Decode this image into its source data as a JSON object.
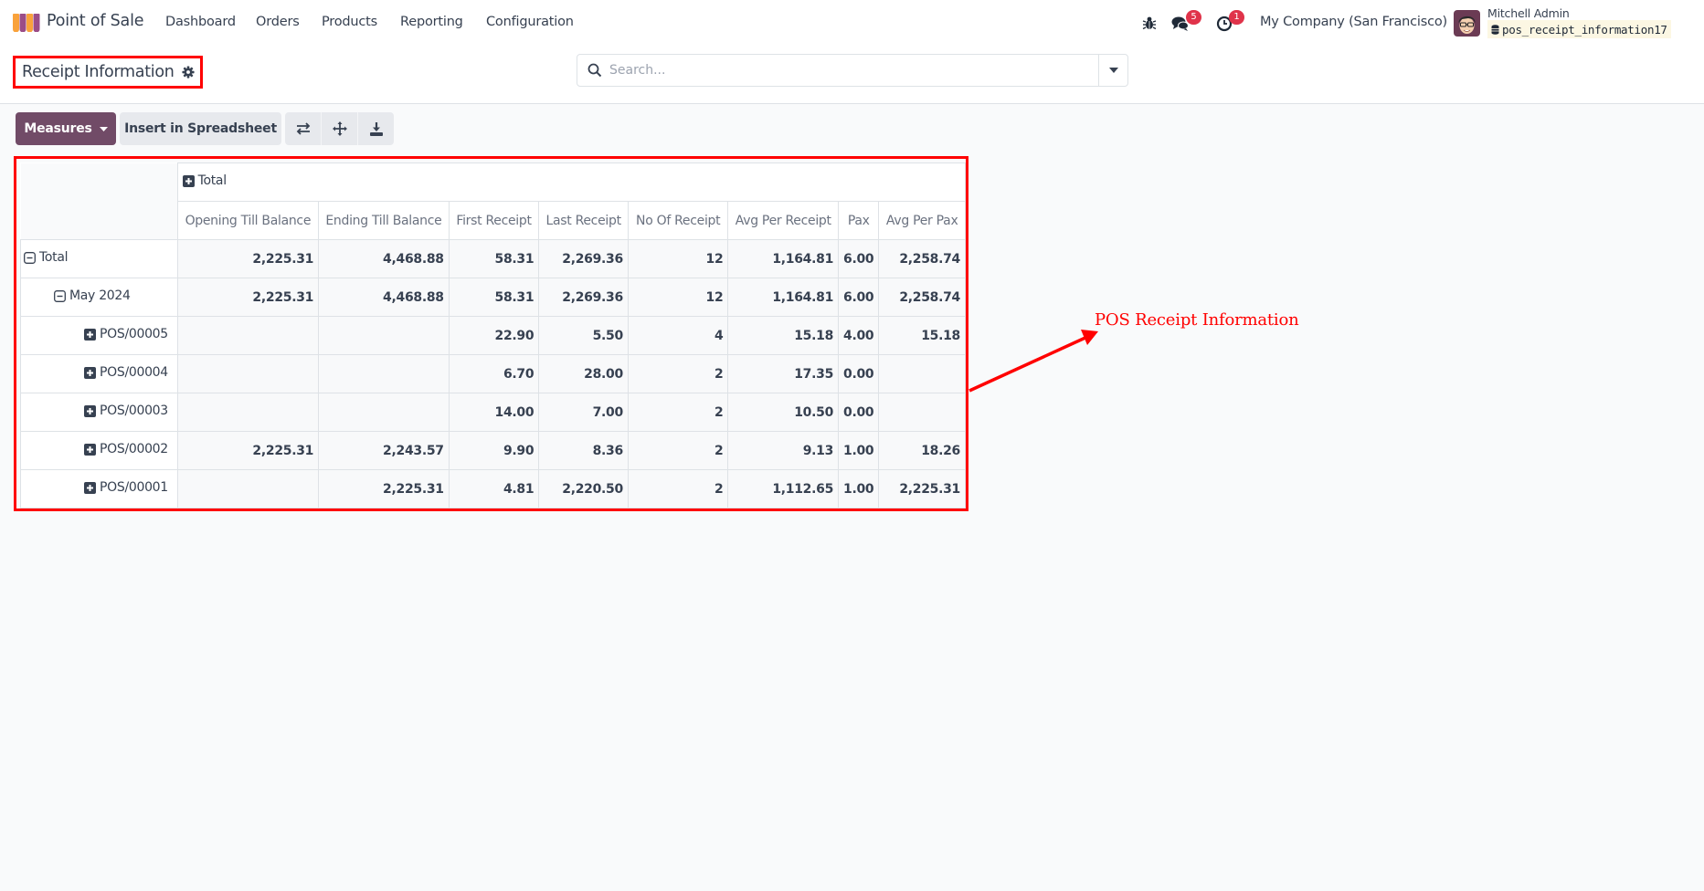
{
  "navbar": {
    "app_name": "Point of Sale",
    "menu": [
      "Dashboard",
      "Orders",
      "Products",
      "Reporting",
      "Configuration"
    ],
    "icons": {
      "debug": "bug-icon",
      "messages": "chat-icon",
      "activities": "clock-icon"
    },
    "messages_badge": "5",
    "activities_badge": "1",
    "company": "My Company (San Francisco)",
    "user_name": "Mitchell Admin",
    "database": "pos_receipt_information17"
  },
  "control_panel": {
    "title": "Receipt Information",
    "search": {
      "placeholder": "Search...",
      "value": ""
    }
  },
  "toolbar": {
    "measures_label": "Measures",
    "spreadsheet_label": "Insert in Spreadsheet",
    "icon_buttons": [
      "flip-axis-icon",
      "expand-all-icon",
      "download-icon"
    ]
  },
  "pivot": {
    "column_group": "Total",
    "measures": [
      "Opening Till Balance",
      "Ending Till Balance",
      "First Receipt",
      "Last Receipt",
      "No Of Receipt",
      "Avg Per Receipt",
      "Pax",
      "Avg Per Pax"
    ],
    "rows": [
      {
        "label": "Total",
        "level": 0,
        "state": "expanded",
        "values": [
          "2,225.31",
          "4,468.88",
          "58.31",
          "2,269.36",
          "12",
          "1,164.81",
          "6.00",
          "2,258.74"
        ]
      },
      {
        "label": "May 2024",
        "level": 1,
        "state": "expanded",
        "values": [
          "2,225.31",
          "4,468.88",
          "58.31",
          "2,269.36",
          "12",
          "1,164.81",
          "6.00",
          "2,258.74"
        ]
      },
      {
        "label": "POS/00005",
        "level": 2,
        "state": "collapsed",
        "values": [
          "",
          "",
          "22.90",
          "5.50",
          "4",
          "15.18",
          "4.00",
          "15.18"
        ]
      },
      {
        "label": "POS/00004",
        "level": 2,
        "state": "collapsed",
        "values": [
          "",
          "",
          "6.70",
          "28.00",
          "2",
          "17.35",
          "0.00",
          ""
        ]
      },
      {
        "label": "POS/00003",
        "level": 2,
        "state": "collapsed",
        "values": [
          "",
          "",
          "14.00",
          "7.00",
          "2",
          "10.50",
          "0.00",
          ""
        ]
      },
      {
        "label": "POS/00002",
        "level": 2,
        "state": "collapsed",
        "values": [
          "2,225.31",
          "2,243.57",
          "9.90",
          "8.36",
          "2",
          "9.13",
          "1.00",
          "18.26"
        ]
      },
      {
        "label": "POS/00001",
        "level": 2,
        "state": "collapsed",
        "values": [
          "",
          "2,225.31",
          "4.81",
          "2,220.50",
          "2",
          "1,112.65",
          "1.00",
          "2,225.31"
        ]
      }
    ]
  },
  "annotation": {
    "text": "POS Receipt Information",
    "color": "#ff0000"
  },
  "colors": {
    "brand": "#714b67",
    "badge": "#e0334a",
    "annotation": "#ff0000"
  }
}
